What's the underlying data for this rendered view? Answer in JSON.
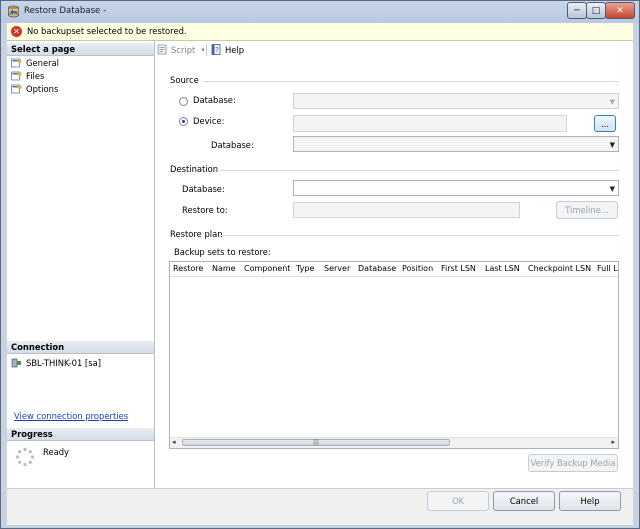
{
  "window": {
    "title": "Restore Database -",
    "minimize_glyph": "─",
    "maximize_glyph": "□",
    "close_glyph": "✕"
  },
  "message": {
    "text": "No backupset selected to be restored.",
    "icon": "error-icon",
    "icon_glyph": "✕"
  },
  "left_pane": {
    "select_page_header": "Select a page",
    "pages": [
      {
        "label": "General"
      },
      {
        "label": "Files"
      },
      {
        "label": "Options"
      }
    ],
    "connection_header": "Connection",
    "connection_server": "SBL-THINK-01 [sa]",
    "view_connection_link": "View connection properties",
    "progress_header": "Progress",
    "progress_status": "Ready"
  },
  "toolbar": {
    "script_label": "Script",
    "script_dropdown_glyph": "▾",
    "help_label": "Help"
  },
  "source": {
    "section_label": "Source",
    "database_radio_label": "Database:",
    "device_radio_label": "Device:",
    "selected": "Device",
    "browse_button": "...",
    "device_database_label": "Database:"
  },
  "destination": {
    "section_label": "Destination",
    "database_label": "Database:",
    "restore_to_label": "Restore to:",
    "timeline_button": "Timeline..."
  },
  "restore_plan": {
    "section_label": "Restore plan",
    "backup_sets_label": "Backup sets to restore:",
    "columns": [
      "Restore",
      "Name",
      "Component",
      "Type",
      "Server",
      "Database",
      "Position",
      "First LSN",
      "Last LSN",
      "Checkpoint LSN",
      "Full LS"
    ],
    "scroll_thumb_grip": "|||",
    "scroll_left_glyph": "◂",
    "scroll_right_glyph": "▸",
    "verify_button": "Verify Backup Media"
  },
  "dialog_buttons": {
    "ok": "OK",
    "cancel": "Cancel",
    "help": "Help"
  },
  "colors": {
    "accent_link": "#1c3fc4",
    "error": "#d8302a",
    "message_bg": "#ffffe1"
  }
}
